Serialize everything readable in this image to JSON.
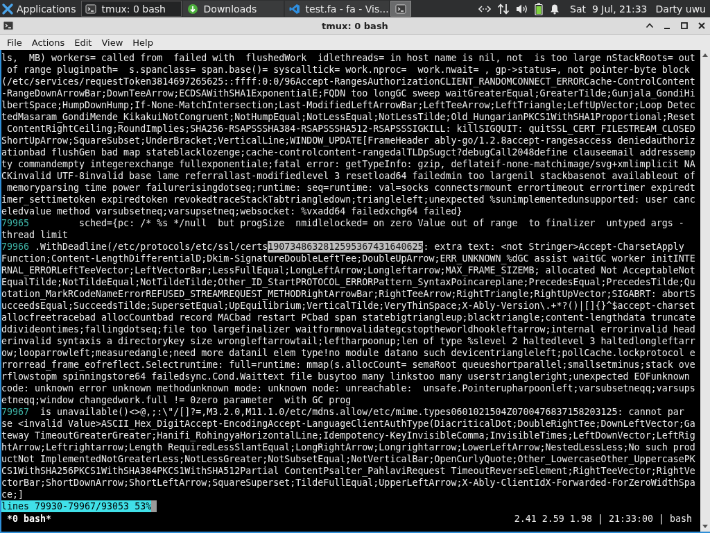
{
  "panel": {
    "launcher": "Applications",
    "tasks": [
      {
        "kind": "terminal",
        "label": "tmux: 0 bash",
        "selected": true
      },
      {
        "kind": "download",
        "label": "Downloads",
        "selected": false
      },
      {
        "kind": "editor",
        "label": "test.fa - fa - Vis...",
        "selected": false
      },
      {
        "kind": "terminal",
        "selected": true
      }
    ],
    "clock": "Sat  9 Jul, 21:33",
    "user": "Darty uwu"
  },
  "window": {
    "title": "tmux: 0 bash",
    "menu": [
      "File",
      "Actions",
      "Edit",
      "View",
      "Help"
    ]
  },
  "terminal": {
    "lines": [
      {
        "text": "ls,  MB) workers= called from  failed with  flushedWork  idlethreads= in host name is nil, not  is too large nStackRoots= out"
      },
      {
        "text": " of range pluginpath=  s.spanclass= span.base()= syscalltick= work.nproc=  work.nwait= , gp->status=, not pointer-byte block"
      },
      {
        "text": "(/etc/services/requestToken3814697265625::ffff:0:0/96Accept-RangesAuthorizationCLIENT_RANDOMCONNECT_ERRORCache-ControlContent"
      },
      {
        "text": "-RangeDownArrowBar;DownTeeArrow;ECDSAWithSHA1ExponentialE;FQDN too longGC sweep waitGreaterEqual;GreaterTilde;Gunjala_GondiHi"
      },
      {
        "text": "lbertSpace;HumpDownHump;If-None-MatchIntersection;Last-ModifiedLeftArrowBar;LeftTeeArrow;LeftTriangle;LeftUpVector;Loop Detec"
      },
      {
        "text": "tedMasaram_GondiMende_KikakuiNotCongruent;NotHumpEqual;NotLessEqual;NotLessTilde;Old_HungarianPKCS1WithSHA1Proportional;Reset"
      },
      {
        "text": " ContentRightCeiling;RoundImplies;SHA256-RSAPSSSHA384-RSAPSSSHA512-RSAPSSSIGKILL: killSIGQUIT: quitSSL_CERT_FILESTREAM_CLOSED"
      },
      {
        "text": "ShortUpArrow;SquareSubset;UnderBracket;VerticalLine;WINDOW_UPDATE[FrameHeader ably-go/1.2.8accept-rangesaccess deniedauthoriz"
      },
      {
        "text": "ationbad flushGen bad map stateblacklozenge;cache-controlcontent-rangedalTLDpSugct?debugCall2048define clauseemail addressemp"
      },
      {
        "text": "ty commandempty integerexchange fullexponentiale;fatal error: getTypeInfo: gzip, deflateif-none-matchimage/svg+xmlimplicit NA"
      },
      {
        "text": "CKinvalid UTF-8invalid base lame referrallast-modifiedlevel 3 resetload64 failedmin too largenil stackbasenot availableout of"
      },
      {
        "text": " memoryparsing time power failurerisingdotseq;runtime: seq=runtime: val=socks connectsrmount errortimeout errortimer expiredt"
      },
      {
        "text": "imer_settimetoken expiredtoken revokedtraceStackTabtriangledown;triangleleft;unexpected %sunimplementedunsupported: user canc"
      },
      {
        "text": "eledvalue method varsubsetneq;varsupsetneq;websocket: %vxadd64 failedxchg64 failed}"
      },
      {
        "number": "79965",
        "text": "         sched={pc: /* %s */null  but progSize  nmidlelocked= on zero Value out of range  to finalizer  untyped args -"
      },
      {
        "text": "thread limit"
      },
      {
        "number": "79966",
        "text": " .WithDeadline(/etc/protocols/etc/ssl/certs",
        "selection": "1907348632812595367431640625",
        "after": ": extra text: <not Stringer>Accept-CharsetApply"
      },
      {
        "text": "Function;Content-LengthDifferentialD;Dkim-SignatureDoubleLeftTee;DoubleUpArrow;ERR_UNKNOWN_%dGC assist waitGC worker initINTE"
      },
      {
        "text": "RNAL_ERRORLeftTeeVector;LeftVectorBar;LessFullEqual;LongLeftArrow;Longleftarrow;MAX_FRAME_SIZEMB; allocated Not AcceptableNot"
      },
      {
        "text": "EqualTilde;NotTildeEqual;NotTildeTilde;Other_ID_StartPROTOCOL_ERRORPattern_SyntaxPoincareplane;PrecedesEqual;PrecedesTilde;Qu"
      },
      {
        "text": "otation_MarkRCodeNameErrorREFUSED_STREAMREQUEST_METHODRightArrowBar;RightTeeArrow;RightTriangle;RightUpVector;SIGABRT: abortS"
      },
      {
        "text": "ucceedsEqual;SucceedsTilde;SupersetEqual;UpEquilibrium;VerticalTilde;VeryThinSpace;X-Ably-Version\\.+*?()|[]{}^$accept-charset"
      },
      {
        "text": "allocfreetracebad allocCountbad record MACbad restart PCbad span statebigtriangleup;blacktriangle;content-lengthdata truncate"
      },
      {
        "text": "ddivideontimes;fallingdotseq;file too largefinalizer waitformnovalidategcstoptheworldhookleftarrow;internal errorinvalid head"
      },
      {
        "text": "erinvalid syntaxis a directorykey size wrongleftarrowtail;leftharpoonup;len of type %slevel 2 haltedlevel 3 haltedlongleftarr"
      },
      {
        "text": "ow;looparrowleft;measuredangle;need more datanil elem type!no module datano such devicentriangleleft;pollCache.lockprotocol e"
      },
      {
        "text": "rrorread_frame_eofreflect.Selectruntime: full=runtime: mmap(s.allocCount= semaRoot queueshortparallel;smallsetminus;stack ove"
      },
      {
        "text": "rflowstopm spinningstore64 failedsync.Cond.Waittext file busytoo many linkstoo many userstriangleright;unexpected EOFunknown"
      },
      {
        "text": "code: unknown error unknown methodunknown mode: unknown node: unreachable:  unsafe.Pointerupharpoonleft;varsubsetneqq;varsups"
      },
      {
        "text": "etneqq;window changedwork.full != 0zero parameter  with GC prog"
      },
      {
        "number": "79967",
        "text": "  is unavailable()<>@,;:\\\"/[]?=,M3.2.0,M11.1.0/etc/mdns.allow/etc/mime.types0601021504Z0700476837158203125: cannot par"
      },
      {
        "text": "se <invalid Value>ASCII_Hex_DigitAccept-EncodingAccept-LanguageClientAuthType(DiacriticalDot;DoubleRightTee;DownLeftVector;Ga"
      },
      {
        "text": "teway TimeoutGreaterGreater;Hanifi_RohingyaHorizontalLine;Idempotency-KeyInvisibleComma;InvisibleTimes;LeftDownVector;LeftRig"
      },
      {
        "text": "htArrow;Leftrightarrow;Length RequiredLessSlantEqual;LongRightArrow;Longrightarrow;LowerLeftArrow;NestedLessLess;No such prod"
      },
      {
        "text": "uctNot ImplementedNotGreaterLess;NotLessGreater;NotSubsetEqual;NotVerticalBar;OpenCurlyQuote;Other_LowercaseOther_UppercasePK"
      },
      {
        "text": "CS1WithSHA256PKCS1WithSHA384PKCS1WithSHA512Partial ContentPsalter_PahlaviRequest TimeoutReverseElement;RightTeeVector;RightVe"
      },
      {
        "text": "ctorBar;ShortDownArrow;ShortLeftArrow;SquareSuperset;TildeFullEqual;UpperLeftArrow;X-Ably-ClientIdX-Forwarded-ForZeroWidthSpa"
      },
      {
        "text": "ce;]"
      }
    ],
    "pager_status": "lines 79930-79967/93053 53%",
    "tmux": {
      "windows": "*0 bash*",
      "status": "2.41 2.59 1.98 | 21:33:00 | bash"
    }
  }
}
